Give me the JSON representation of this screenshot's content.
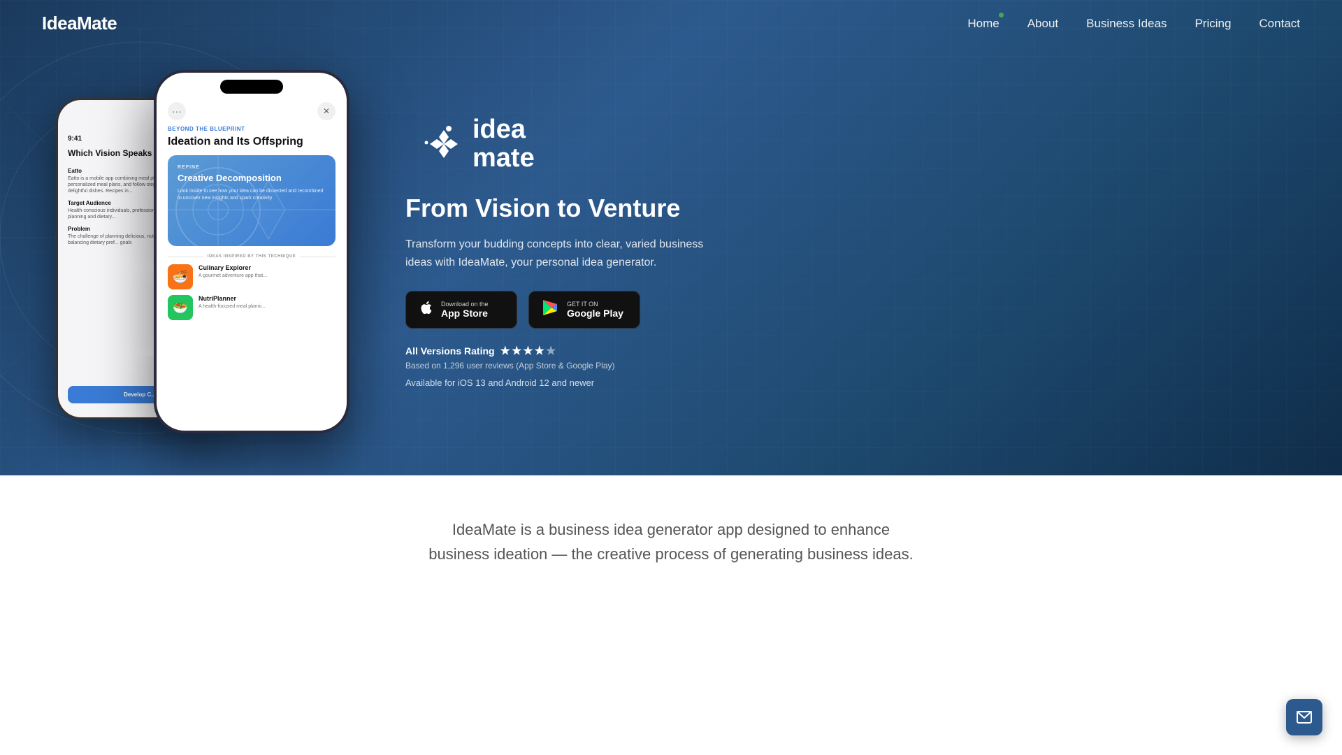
{
  "nav": {
    "logo": "IdeaMate",
    "links": [
      {
        "label": "Home",
        "id": "home",
        "active": true
      },
      {
        "label": "About",
        "id": "about",
        "active": false
      },
      {
        "label": "Business Ideas",
        "id": "business-ideas",
        "active": false
      },
      {
        "label": "Pricing",
        "id": "pricing",
        "active": false
      },
      {
        "label": "Contact",
        "id": "contact",
        "active": false
      }
    ]
  },
  "hero": {
    "brand_name_line1": "idea",
    "brand_name_line2": "mate",
    "headline": "From Vision to Venture",
    "subtext": "Transform your budding concepts into clear, varied business ideas with IdeaMate, your personal idea generator.",
    "app_store_label_small": "Download on the",
    "app_store_label_big": "App Store",
    "google_play_label_small": "GET IT ON",
    "google_play_label_big": "Google Play",
    "rating_label": "All Versions Rating",
    "rating_count": "Based on 1,296 user reviews (App Store & Google Play)",
    "platform_availability": "Available for iOS 13 and Android 12 and newer"
  },
  "phone_front": {
    "subtitle": "BEYOND THE BLUEPRINT",
    "title": "Ideation and Its Offspring",
    "card_label": "REFINE",
    "card_title": "Creative Decomposition",
    "card_text": "Look inside to see how your idea can be dissected and recombined to uncover new insights and spark creativity",
    "divider_text": "IDEAS INSPIRED BY THIS TECHNIQUE",
    "idea1_name": "Culinary Explorer",
    "idea1_desc": "A gourmet adventure app that...",
    "idea2_name": "NutriPlanner",
    "idea2_desc": "A health-focused meal planni..."
  },
  "phone_back": {
    "time": "9:41",
    "title": "Which Vision Speaks to You",
    "section1_title": "Eatto",
    "section1_text": "Eatto is a mobile app combining meal planning that let's use personalized meal plans, and follow step-by-step to make delightful dishes. Recipes in...",
    "section2_title": "Target Audience",
    "section2_text": "Health-conscious individuals, professionals, and families for meal planning and dietary...",
    "section3_title": "Problem",
    "section3_text": "The challenge of planning delicious, nutritious meals while balancing dietary pref... goals",
    "btn_label": "Develop C..."
  },
  "lower": {
    "text": "IdeaMate is a business idea generator app designed to enhance business ideation — the creative process of generating business ideas."
  }
}
